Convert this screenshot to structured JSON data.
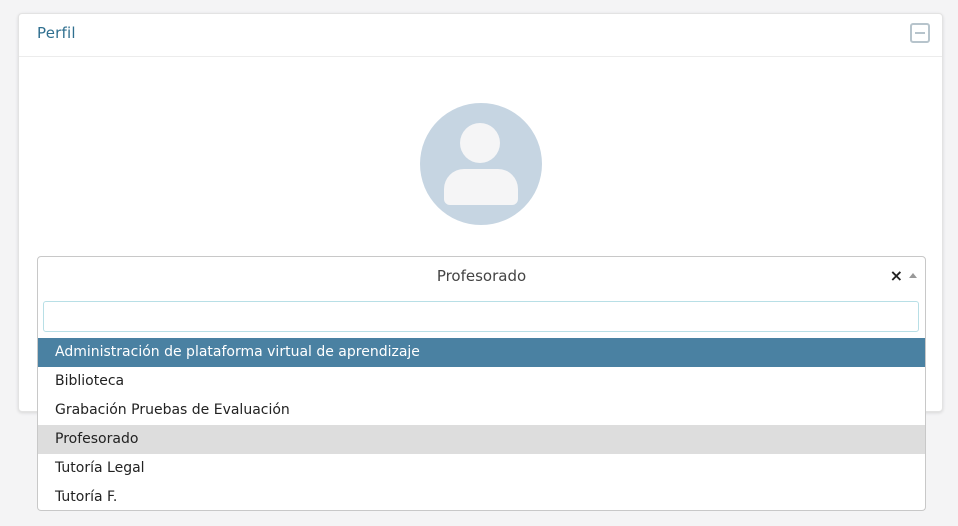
{
  "panel": {
    "title": "Perfil",
    "collapse_icon": "minus-square-icon"
  },
  "avatar": {
    "icon": "user-avatar-icon",
    "color": "#c6d5e2"
  },
  "profile_select": {
    "selected_value": "Profesorado",
    "clear_icon": "×",
    "arrow_icon": "caret-up-icon",
    "search": {
      "value": "",
      "placeholder": ""
    },
    "options": [
      {
        "label": "Administración de plataforma virtual de aprendizaje",
        "state": "highlighted"
      },
      {
        "label": "Biblioteca",
        "state": ""
      },
      {
        "label": "Grabación Pruebas de Evaluación",
        "state": ""
      },
      {
        "label": "Profesorado",
        "state": "selected"
      },
      {
        "label": "Tutoría Legal",
        "state": ""
      },
      {
        "label": "Tutoría F.",
        "state": ""
      }
    ]
  },
  "colors": {
    "title": "#2f6f8f",
    "highlight": "#4a81a2",
    "selected": "#dddddd"
  }
}
